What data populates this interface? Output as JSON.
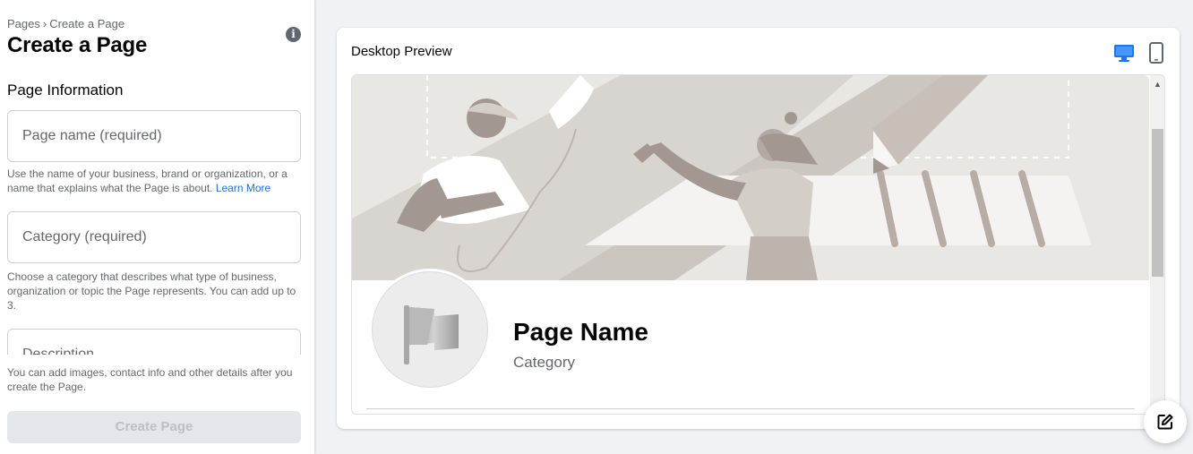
{
  "sidebar": {
    "breadcrumb": {
      "root": "Pages",
      "separator": "›",
      "current": "Create a Page"
    },
    "title": "Create a Page",
    "section_title": "Page Information",
    "fields": [
      {
        "placeholder": "Page name (required)",
        "value": ""
      },
      {
        "placeholder": "Category (required)",
        "value": ""
      },
      {
        "placeholder": "Description",
        "value": ""
      }
    ],
    "help_name": "Use the name of your business, brand or organization, or a name that explains what the Page is about.",
    "help_name_link": "Learn More",
    "help_category": "Choose a category that describes what type of business, organization or topic the Page represents. You can add up to 3.",
    "footer_text": "You can add images, contact info and other details after you create the Page.",
    "create_button": "Create Page"
  },
  "preview": {
    "title": "Desktop Preview",
    "page_name": "Page Name",
    "category": "Category",
    "modes": [
      "desktop-icon",
      "mobile-icon"
    ],
    "active_mode": "desktop"
  },
  "colors": {
    "accent": "#1877f2",
    "link": "#216fdb",
    "disabled_button_bg": "#e4e6eb",
    "disabled_button_text": "#bcc0c4"
  }
}
